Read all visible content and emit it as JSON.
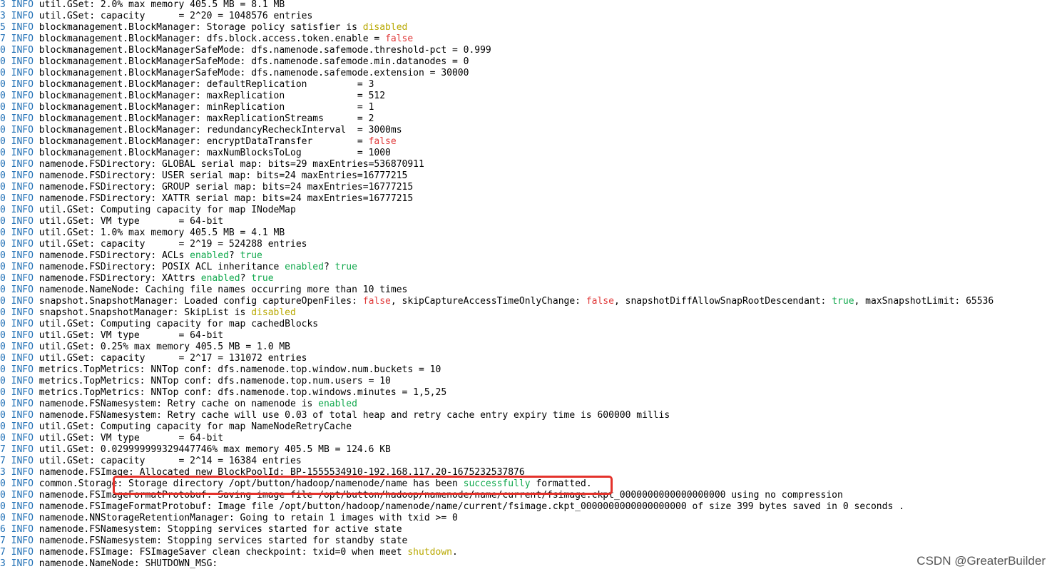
{
  "terminal": {
    "colors": {
      "background": "#ffffff",
      "prefix": "#1f6fb5",
      "default": "#000000",
      "yellow": "#b8a800",
      "red": "#e03a3a",
      "green": "#10a84c",
      "highlight_box": "#e4322b"
    },
    "lines": [
      {
        "prefix": "3 INFO",
        "segments": [
          {
            "t": " util.GSet: 2.0% max memory 405.5 MB = 8.1 MB",
            "c": "default"
          }
        ]
      },
      {
        "prefix": "3 INFO",
        "segments": [
          {
            "t": " util.GSet: capacity      = 2^20 = 1048576 entries",
            "c": "default"
          }
        ]
      },
      {
        "prefix": "5 INFO",
        "segments": [
          {
            "t": " blockmanagement.BlockManager: Storage policy satisfier is ",
            "c": "default"
          },
          {
            "t": "disabled",
            "c": "yellow"
          }
        ]
      },
      {
        "prefix": "7 INFO",
        "segments": [
          {
            "t": " blockmanagement.BlockManager: dfs.block.access.token.enable = ",
            "c": "default"
          },
          {
            "t": "false",
            "c": "red"
          }
        ]
      },
      {
        "prefix": "0 INFO",
        "segments": [
          {
            "t": " blockmanagement.BlockManagerSafeMode: dfs.namenode.safemode.threshold-pct = 0.999",
            "c": "default"
          }
        ]
      },
      {
        "prefix": "0 INFO",
        "segments": [
          {
            "t": " blockmanagement.BlockManagerSafeMode: dfs.namenode.safemode.min.datanodes = 0",
            "c": "default"
          }
        ]
      },
      {
        "prefix": "0 INFO",
        "segments": [
          {
            "t": " blockmanagement.BlockManagerSafeMode: dfs.namenode.safemode.extension = 30000",
            "c": "default"
          }
        ]
      },
      {
        "prefix": "0 INFO",
        "segments": [
          {
            "t": " blockmanagement.BlockManager: defaultReplication         = 3",
            "c": "default"
          }
        ]
      },
      {
        "prefix": "0 INFO",
        "segments": [
          {
            "t": " blockmanagement.BlockManager: maxReplication             = 512",
            "c": "default"
          }
        ]
      },
      {
        "prefix": "0 INFO",
        "segments": [
          {
            "t": " blockmanagement.BlockManager: minReplication             = 1",
            "c": "default"
          }
        ]
      },
      {
        "prefix": "0 INFO",
        "segments": [
          {
            "t": " blockmanagement.BlockManager: maxReplicationStreams      = 2",
            "c": "default"
          }
        ]
      },
      {
        "prefix": "0 INFO",
        "segments": [
          {
            "t": " blockmanagement.BlockManager: redundancyRecheckInterval  = 3000ms",
            "c": "default"
          }
        ]
      },
      {
        "prefix": "0 INFO",
        "segments": [
          {
            "t": " blockmanagement.BlockManager: encryptDataTransfer        = ",
            "c": "default"
          },
          {
            "t": "false",
            "c": "red"
          }
        ]
      },
      {
        "prefix": "0 INFO",
        "segments": [
          {
            "t": " blockmanagement.BlockManager: maxNumBlocksToLog          = 1000",
            "c": "default"
          }
        ]
      },
      {
        "prefix": "0 INFO",
        "segments": [
          {
            "t": " namenode.FSDirectory: GLOBAL serial map: bits=29 maxEntries=536870911",
            "c": "default"
          }
        ]
      },
      {
        "prefix": "0 INFO",
        "segments": [
          {
            "t": " namenode.FSDirectory: USER serial map: bits=24 maxEntries=16777215",
            "c": "default"
          }
        ]
      },
      {
        "prefix": "0 INFO",
        "segments": [
          {
            "t": " namenode.FSDirectory: GROUP serial map: bits=24 maxEntries=16777215",
            "c": "default"
          }
        ]
      },
      {
        "prefix": "0 INFO",
        "segments": [
          {
            "t": " namenode.FSDirectory: XATTR serial map: bits=24 maxEntries=16777215",
            "c": "default"
          }
        ]
      },
      {
        "prefix": "0 INFO",
        "segments": [
          {
            "t": " util.GSet: Computing capacity for map INodeMap",
            "c": "default"
          }
        ]
      },
      {
        "prefix": "0 INFO",
        "segments": [
          {
            "t": " util.GSet: VM type       = 64-bit",
            "c": "default"
          }
        ]
      },
      {
        "prefix": "0 INFO",
        "segments": [
          {
            "t": " util.GSet: 1.0% max memory 405.5 MB = 4.1 MB",
            "c": "default"
          }
        ]
      },
      {
        "prefix": "0 INFO",
        "segments": [
          {
            "t": " util.GSet: capacity      = 2^19 = 524288 entries",
            "c": "default"
          }
        ]
      },
      {
        "prefix": "0 INFO",
        "segments": [
          {
            "t": " namenode.FSDirectory: ACLs ",
            "c": "default"
          },
          {
            "t": "enabled",
            "c": "green"
          },
          {
            "t": "? ",
            "c": "default"
          },
          {
            "t": "true",
            "c": "green"
          }
        ]
      },
      {
        "prefix": "0 INFO",
        "segments": [
          {
            "t": " namenode.FSDirectory: POSIX ACL inheritance ",
            "c": "default"
          },
          {
            "t": "enabled",
            "c": "green"
          },
          {
            "t": "? ",
            "c": "default"
          },
          {
            "t": "true",
            "c": "green"
          }
        ]
      },
      {
        "prefix": "0 INFO",
        "segments": [
          {
            "t": " namenode.FSDirectory: XAttrs ",
            "c": "default"
          },
          {
            "t": "enabled",
            "c": "green"
          },
          {
            "t": "? ",
            "c": "default"
          },
          {
            "t": "true",
            "c": "green"
          }
        ]
      },
      {
        "prefix": "0 INFO",
        "segments": [
          {
            "t": " namenode.NameNode: Caching file names occurring more than 10 times",
            "c": "default"
          }
        ]
      },
      {
        "prefix": "0 INFO",
        "segments": [
          {
            "t": " snapshot.SnapshotManager: Loaded config captureOpenFiles: ",
            "c": "default"
          },
          {
            "t": "false",
            "c": "red"
          },
          {
            "t": ", skipCaptureAccessTimeOnlyChange: ",
            "c": "default"
          },
          {
            "t": "false",
            "c": "red"
          },
          {
            "t": ", snapshotDiffAllowSnapRootDescendant: ",
            "c": "default"
          },
          {
            "t": "true",
            "c": "green"
          },
          {
            "t": ", maxSnapshotLimit: 65536",
            "c": "default"
          }
        ]
      },
      {
        "prefix": "0 INFO",
        "segments": [
          {
            "t": " snapshot.SnapshotManager: SkipList is ",
            "c": "default"
          },
          {
            "t": "disabled",
            "c": "yellow"
          }
        ]
      },
      {
        "prefix": "0 INFO",
        "segments": [
          {
            "t": " util.GSet: Computing capacity for map cachedBlocks",
            "c": "default"
          }
        ]
      },
      {
        "prefix": "0 INFO",
        "segments": [
          {
            "t": " util.GSet: VM type       = 64-bit",
            "c": "default"
          }
        ]
      },
      {
        "prefix": "0 INFO",
        "segments": [
          {
            "t": " util.GSet: 0.25% max memory 405.5 MB = 1.0 MB",
            "c": "default"
          }
        ]
      },
      {
        "prefix": "0 INFO",
        "segments": [
          {
            "t": " util.GSet: capacity      = 2^17 = 131072 entries",
            "c": "default"
          }
        ]
      },
      {
        "prefix": "0 INFO",
        "segments": [
          {
            "t": " metrics.TopMetrics: NNTop conf: dfs.namenode.top.window.num.buckets = 10",
            "c": "default"
          }
        ]
      },
      {
        "prefix": "0 INFO",
        "segments": [
          {
            "t": " metrics.TopMetrics: NNTop conf: dfs.namenode.top.num.users = 10",
            "c": "default"
          }
        ]
      },
      {
        "prefix": "0 INFO",
        "segments": [
          {
            "t": " metrics.TopMetrics: NNTop conf: dfs.namenode.top.windows.minutes = 1,5,25",
            "c": "default"
          }
        ]
      },
      {
        "prefix": "0 INFO",
        "segments": [
          {
            "t": " namenode.FSNamesystem: Retry cache on namenode is ",
            "c": "default"
          },
          {
            "t": "enabled",
            "c": "green"
          }
        ]
      },
      {
        "prefix": "0 INFO",
        "segments": [
          {
            "t": " namenode.FSNamesystem: Retry cache will use 0.03 of total heap and retry cache entry expiry time is 600000 millis",
            "c": "default"
          }
        ]
      },
      {
        "prefix": "0 INFO",
        "segments": [
          {
            "t": " util.GSet: Computing capacity for map NameNodeRetryCache",
            "c": "default"
          }
        ]
      },
      {
        "prefix": "0 INFO",
        "segments": [
          {
            "t": " util.GSet: VM type       = 64-bit",
            "c": "default"
          }
        ]
      },
      {
        "prefix": "7 INFO",
        "segments": [
          {
            "t": " util.GSet: 0.029999999329447746% max memory 405.5 MB = 124.6 KB",
            "c": "default"
          }
        ]
      },
      {
        "prefix": "7 INFO",
        "segments": [
          {
            "t": " util.GSet: capacity      = 2^14 = 16384 entries",
            "c": "default"
          }
        ]
      },
      {
        "prefix": "3 INFO",
        "segments": [
          {
            "t": " namenode.FSImage: Allocated new BlockPoolId: BP-1555534910-192.168.117.20-1675232537876",
            "c": "default"
          }
        ]
      },
      {
        "prefix": "0 INFO",
        "segments": [
          {
            "t": " common.Storage: Storage directory /opt/button/hadoop/namenode/name has been ",
            "c": "default"
          },
          {
            "t": "successfully",
            "c": "green"
          },
          {
            "t": " formatted.",
            "c": "default"
          }
        ]
      },
      {
        "prefix": "0 INFO",
        "segments": [
          {
            "t": " namenode.FSImageFormatProtobuf: Saving image file /opt/button/hadoop/namenode/name/current/fsimage.ckpt_0000000000000000000 using no compression",
            "c": "default"
          }
        ]
      },
      {
        "prefix": "0 INFO",
        "segments": [
          {
            "t": " namenode.FSImageFormatProtobuf: Image file /opt/button/hadoop/namenode/name/current/fsimage.ckpt_0000000000000000000 of size 399 bytes saved in 0 seconds .",
            "c": "default"
          }
        ]
      },
      {
        "prefix": "0 INFO",
        "segments": [
          {
            "t": " namenode.NNStorageRetentionManager: Going to retain 1 images with txid >= 0",
            "c": "default"
          }
        ]
      },
      {
        "prefix": "6 INFO",
        "segments": [
          {
            "t": " namenode.FSNamesystem: Stopping services started for active state",
            "c": "default"
          }
        ]
      },
      {
        "prefix": "7 INFO",
        "segments": [
          {
            "t": " namenode.FSNamesystem: Stopping services started for standby state",
            "c": "default"
          }
        ]
      },
      {
        "prefix": "7 INFO",
        "segments": [
          {
            "t": " namenode.FSImage: FSImageSaver clean checkpoint: txid=0 when meet ",
            "c": "default"
          },
          {
            "t": "shutdown",
            "c": "yellow"
          },
          {
            "t": ".",
            "c": "default"
          }
        ]
      },
      {
        "prefix": "3 INFO",
        "segments": [
          {
            "t": " namenode.NameNode: SHUTDOWN_MSG:",
            "c": "default"
          }
        ]
      }
    ]
  },
  "watermark": {
    "text": "CSDN @GreaterBuilder"
  }
}
